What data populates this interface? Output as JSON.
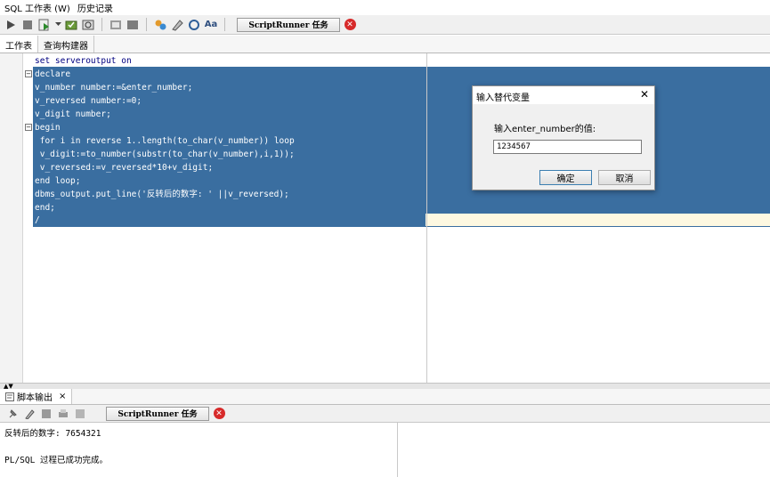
{
  "menubar": {
    "items": [
      {
        "label": "SQL 工作表 (W)"
      },
      {
        "label": "历史记录"
      }
    ]
  },
  "toolbar": {
    "icons": [
      "run-icon",
      "stop-run-icon",
      "run-script-icon",
      "dropdown-icon",
      "commit-icon",
      "rollback-icon",
      "autotrace-icon",
      "explain-icon",
      "sql-tuning-icon",
      "clear-icon",
      "find-icon",
      "format-icon"
    ],
    "script_runner_label": "ScriptRunner 任务",
    "cancel_icon": "cancel-task-icon"
  },
  "tabs": [
    {
      "label": "工作表",
      "active": true
    },
    {
      "label": "查询构建器",
      "active": false
    }
  ],
  "editor": {
    "lines": [
      "set serveroutput on",
      "declare",
      "v_number number:=&enter_number;",
      "v_reversed number:=0;",
      "v_digit number;",
      "begin",
      " for i in reverse 1..length(to_char(v_number)) loop",
      " v_digit:=to_number(substr(to_char(v_number),i,1));",
      " v_reversed:=v_reversed*10+v_digit;",
      "end loop;",
      "dbms_output.put_line('反转后的数字: ' ||v_reversed);",
      "end;",
      "/"
    ],
    "selection_color": "#3a6ea0"
  },
  "dialog": {
    "title": "输入替代变量",
    "close_glyph": "✕",
    "prompt": "输入enter_number的值:",
    "value": "1234567",
    "ok_label": "确定",
    "cancel_label": "取消"
  },
  "output_panel": {
    "splitter_glyph": "▲▼",
    "tab_label": "脚本输出",
    "tab_close": "×",
    "script_runner_label": "ScriptRunner 任务",
    "lines": [
      "反转后的数字: 7654321",
      "",
      "PL/SQL 过程已成功完成。"
    ]
  }
}
